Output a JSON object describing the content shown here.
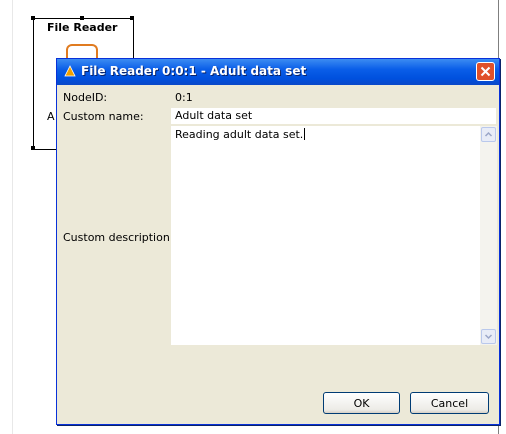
{
  "background_node": {
    "title": "File Reader",
    "label_fragment": "A"
  },
  "dialog": {
    "title": "File Reader 0:0:1 - Adult data set",
    "node_id_label": "NodeID:",
    "node_id_value": "0:1",
    "custom_name_label": "Custom name:",
    "custom_name_value": "Adult data set",
    "custom_description_label": "Custom description:",
    "custom_description_value": "Reading adult data set.",
    "ok_label": "OK",
    "cancel_label": "Cancel"
  },
  "colors": {
    "title_bar": "#0a5ee8",
    "dialog_bg": "#ece9d8",
    "close_button": "#e0502a",
    "node_icon": "#e07b20"
  },
  "icons": {
    "title": "warning-triangle-icon",
    "close": "close-icon",
    "scroll_up": "scroll-up-arrow-icon",
    "scroll_down": "scroll-down-arrow-icon"
  }
}
